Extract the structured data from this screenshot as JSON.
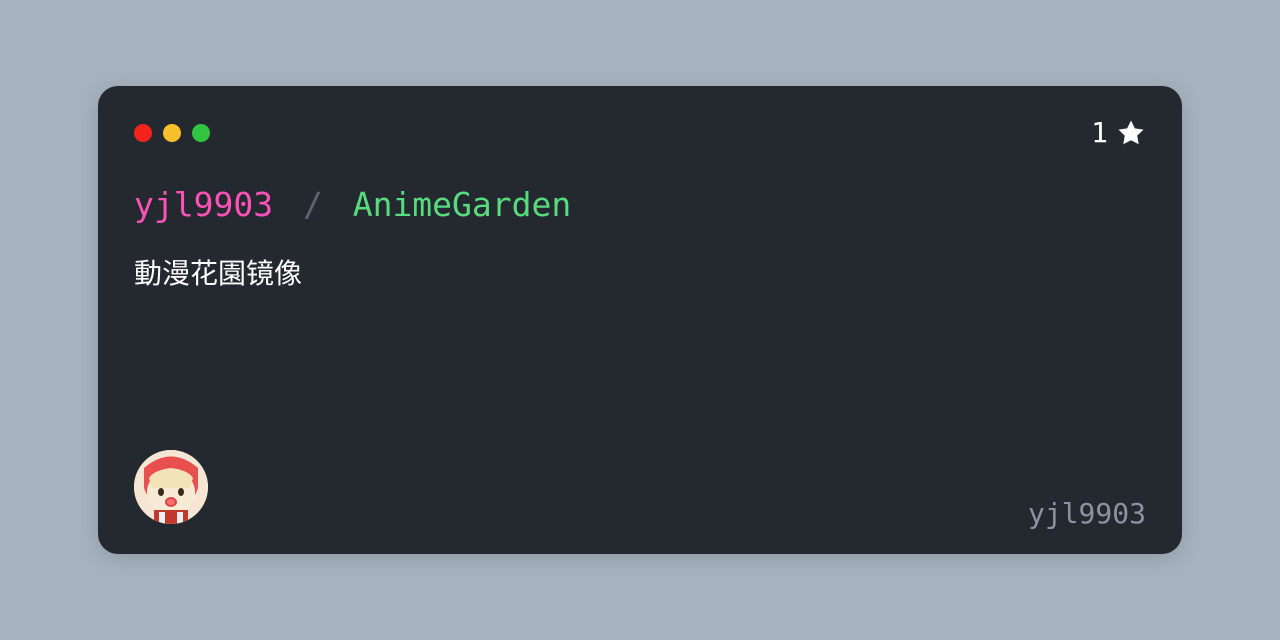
{
  "repo": {
    "owner": "yjl9903",
    "separator": "/",
    "name": "AnimeGarden",
    "description": "動漫花園镜像",
    "stars": "1",
    "username": "yjl9903"
  }
}
